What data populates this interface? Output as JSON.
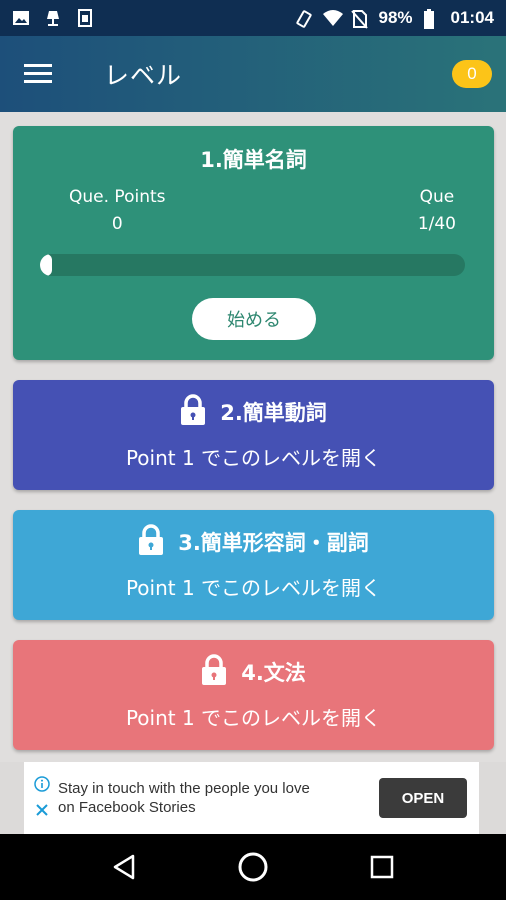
{
  "status_bar": {
    "battery": "98%",
    "time": "01:04",
    "icons": [
      "image-icon",
      "lamp-icon",
      "sim-icon",
      "vibrate-icon",
      "wifi-icon",
      "no-sim-icon",
      "battery-icon"
    ]
  },
  "app_bar": {
    "title": "レベル",
    "coin_count": "0",
    "menu_icon": "hamburger-menu-icon"
  },
  "levels": {
    "level1": {
      "title": "1.簡単名詞",
      "left_label": "Que. Points",
      "left_value": "0",
      "right_label": "Que",
      "right_value": "1/40",
      "progress_fraction": 0.025,
      "start_label": "始める"
    },
    "level2": {
      "title": "2.簡単動詞",
      "unlock_text": "Point 1 でこのレベルを開く"
    },
    "level3": {
      "title": "3.簡単形容詞・副詞",
      "unlock_text": "Point 1 でこのレベルを開く"
    },
    "level4": {
      "title": "4.文法",
      "unlock_text": "Point 1 でこのレベルを開く"
    }
  },
  "ad": {
    "line1": "Stay in touch with the people you love",
    "line2": "on Facebook Stories",
    "button": "OPEN"
  },
  "colors": {
    "level1": "#2e9179",
    "level2": "#4551b4",
    "level3": "#3ea7d6",
    "level4": "#e8757a",
    "coin": "#fcc418"
  }
}
